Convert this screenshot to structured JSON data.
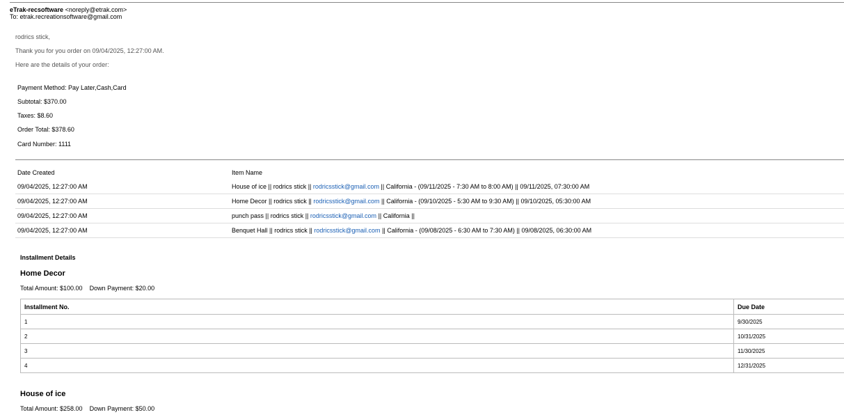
{
  "email": {
    "from_name": "eTrak-recsoftware",
    "from_addr": "<noreply@etrak.com>",
    "to": "To: etrak.recreationsoftware@gmail.com"
  },
  "greeting": {
    "salutation": "rodrics stick,",
    "thanks": "Thank you for you order on 09/04/2025, 12:27:00 AM.",
    "intro": "Here are the details of your order:"
  },
  "order": {
    "payment_method": "Payment Method: Pay Later,Cash,Card",
    "subtotal": "Subtotal: $370.00",
    "taxes": "Taxes: $8.60",
    "total": "Order Total: $378.60",
    "card": "Card Number: 1111"
  },
  "items_table": {
    "headers": [
      "Date Created",
      "Item Name"
    ],
    "rows": [
      {
        "date": "09/04/2025, 12:27:00 AM",
        "pre": "House of ice || rodrics stick || ",
        "email": "rodricsstick@gmail.com",
        "post": " || California - (09/11/2025 - 7:30 AM to 8:00 AM) || 09/11/2025, 07:30:00 AM"
      },
      {
        "date": "09/04/2025, 12:27:00 AM",
        "pre": "Home Decor || rodrics stick || ",
        "email": "rodricsstick@gmail.com",
        "post": " || California - (09/10/2025 - 5:30 AM to 9:30 AM) || 09/10/2025, 05:30:00 AM"
      },
      {
        "date": "09/04/2025, 12:27:00 AM",
        "pre": "punch pass || rodrics stick || ",
        "email": "rodricsstick@gmail.com",
        "post": " || California ||"
      },
      {
        "date": "09/04/2025, 12:27:00 AM",
        "pre": "Benquet Hall || rodrics stick || ",
        "email": "rodricsstick@gmail.com",
        "post": " || California - (09/08/2025 - 6:30 AM to 7:30 AM) || 09/08/2025, 06:30:00 AM"
      }
    ]
  },
  "installments": {
    "title": "Installment Details",
    "col_no": "Installment No.",
    "col_due": "Due Date",
    "products": [
      {
        "name": "Home Decor",
        "total": "Total Amount: $100.00",
        "down": "Down Payment: $20.00",
        "rows": [
          {
            "no": "1",
            "due": "9/30/2025"
          },
          {
            "no": "2",
            "due": "10/31/2025"
          },
          {
            "no": "3",
            "due": "11/30/2025"
          },
          {
            "no": "4",
            "due": "12/31/2025"
          }
        ]
      },
      {
        "name": "House of ice",
        "total": "Total Amount: $258.00",
        "down": "Down Payment: $50.00"
      }
    ]
  }
}
